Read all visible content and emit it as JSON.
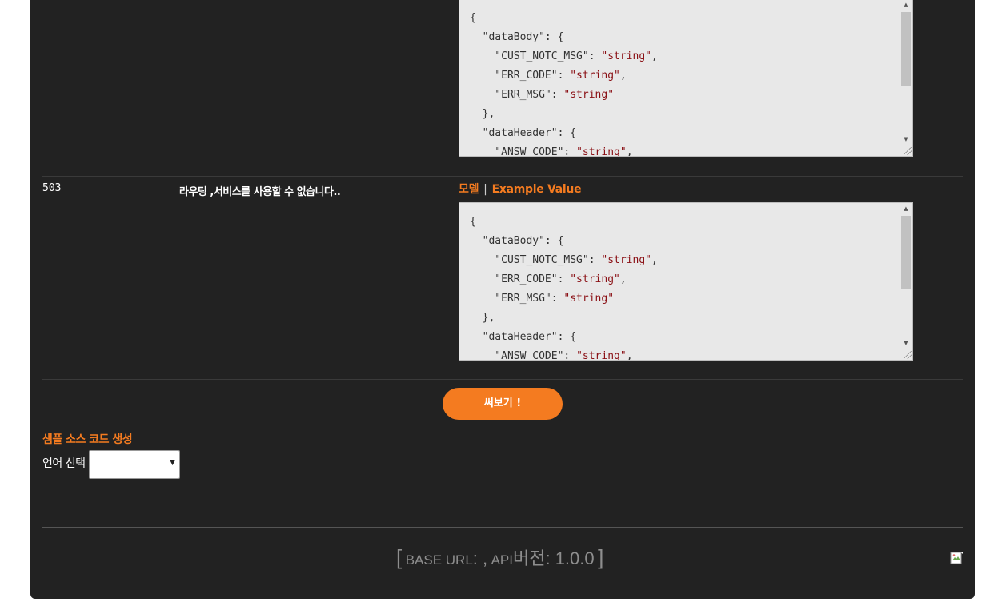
{
  "responses": [
    {
      "code": "",
      "description": "",
      "code_lines": [
        [
          {
            "t": "{",
            "s": false
          }
        ],
        [
          {
            "t": "  \"dataBody\": {",
            "s": false
          }
        ],
        [
          {
            "t": "    \"CUST_NOTC_MSG\": ",
            "s": false
          },
          {
            "t": "\"string\"",
            "s": true
          },
          {
            "t": ",",
            "s": false
          }
        ],
        [
          {
            "t": "    \"ERR_CODE\": ",
            "s": false
          },
          {
            "t": "\"string\"",
            "s": true
          },
          {
            "t": ",",
            "s": false
          }
        ],
        [
          {
            "t": "    \"ERR_MSG\": ",
            "s": false
          },
          {
            "t": "\"string\"",
            "s": true
          }
        ],
        [
          {
            "t": "  },",
            "s": false
          }
        ],
        [
          {
            "t": "  \"dataHeader\": {",
            "s": false
          }
        ],
        [
          {
            "t": "    \"ANSW_CODE\": ",
            "s": false
          },
          {
            "t": "\"string\"",
            "s": true
          },
          {
            "t": ",",
            "s": false
          }
        ]
      ]
    },
    {
      "code": "503",
      "description": "라우팅 ,서비스를 사용할 수 없습니다..",
      "tab_model": "모델",
      "tab_example": "Example Value",
      "code_lines": [
        [
          {
            "t": "{",
            "s": false
          }
        ],
        [
          {
            "t": "  \"dataBody\": {",
            "s": false
          }
        ],
        [
          {
            "t": "    \"CUST_NOTC_MSG\": ",
            "s": false
          },
          {
            "t": "\"string\"",
            "s": true
          },
          {
            "t": ",",
            "s": false
          }
        ],
        [
          {
            "t": "    \"ERR_CODE\": ",
            "s": false
          },
          {
            "t": "\"string\"",
            "s": true
          },
          {
            "t": ",",
            "s": false
          }
        ],
        [
          {
            "t": "    \"ERR_MSG\": ",
            "s": false
          },
          {
            "t": "\"string\"",
            "s": true
          }
        ],
        [
          {
            "t": "  },",
            "s": false
          }
        ],
        [
          {
            "t": "  \"dataHeader\": {",
            "s": false
          }
        ],
        [
          {
            "t": "    \"ANSW_CODE\": ",
            "s": false
          },
          {
            "t": "\"string\"",
            "s": true
          },
          {
            "t": ",",
            "s": false
          }
        ]
      ]
    }
  ],
  "try_button_label": "써보기 !",
  "sample_source": {
    "title": "샘플 소스 코드 생성",
    "language_label": "언어 선택",
    "selected_language": ""
  },
  "footer": {
    "open_bracket": "[",
    "base_url_label": "BASE URL",
    "base_url_sep": ": ,",
    "api_label": "API",
    "version_label": "버전",
    "version_value": ": 1.0.0",
    "close_bracket": "]"
  },
  "colors": {
    "accent": "#f47b20",
    "panel_bg": "#222222",
    "code_bg": "#e8e8e8",
    "string_color": "#8a0f14"
  },
  "icons": {
    "broken_image": "broken-image-icon",
    "scroll_up": "scroll-up-arrow-icon",
    "scroll_down": "scroll-down-arrow-icon",
    "dropdown": "chevron-down-icon"
  }
}
